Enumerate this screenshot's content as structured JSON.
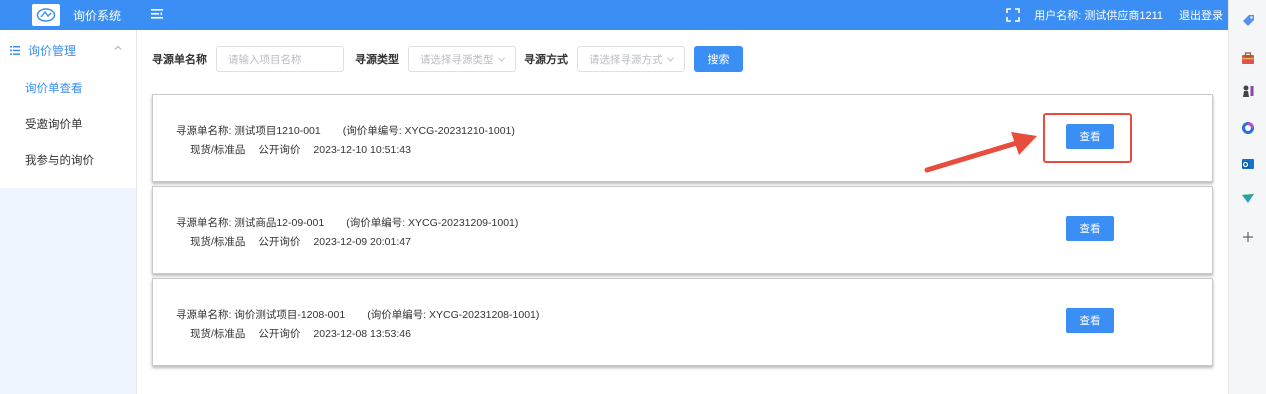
{
  "app": {
    "title": "询价系统"
  },
  "header": {
    "user_label": "用户名称: 测试供应商1211",
    "logout": "退出登录"
  },
  "sidebar": {
    "group_label": "询价管理",
    "items": [
      {
        "label": "询价单查看",
        "active": true
      },
      {
        "label": "受邀询价单",
        "active": false
      },
      {
        "label": "我参与的询价",
        "active": false
      }
    ]
  },
  "filters": {
    "name_label": "寻源单名称",
    "name_placeholder": "请输入项目名称",
    "type_label": "寻源类型",
    "type_placeholder": "请选择寻源类型",
    "method_label": "寻源方式",
    "method_placeholder": "请选择寻源方式",
    "search_label": "搜索"
  },
  "cards": [
    {
      "name": "寻源单名称: 测试项目1210-001",
      "code": "(询价单编号: XYCG-20231210-1001)",
      "category": "现货/标准品",
      "method": "公开询价",
      "datetime": "2023-12-10 10:51:43",
      "button": "查看"
    },
    {
      "name": "寻源单名称: 测试商品12-09-001",
      "code": "(询价单编号: XYCG-20231209-1001)",
      "category": "现货/标准品",
      "method": "公开询价",
      "datetime": "2023-12-09 20:01:47",
      "button": "查看"
    },
    {
      "name": "寻源单名称: 询价测试项目-1208-001",
      "code": "(询价单编号: XYCG-20231208-1001)",
      "category": "现货/标准品",
      "method": "公开询价",
      "datetime": "2023-12-08 13:53:46",
      "button": "查看"
    }
  ],
  "colors": {
    "primary": "#3b8ff4",
    "highlight": "#e74c3c",
    "sidebar_bg": "#eef5fd"
  },
  "right_panel_icons": [
    "tag-icon",
    "toolbox-icon",
    "chess-icon",
    "copilot-icon",
    "outlook-icon",
    "send-icon",
    "plus-icon"
  ]
}
